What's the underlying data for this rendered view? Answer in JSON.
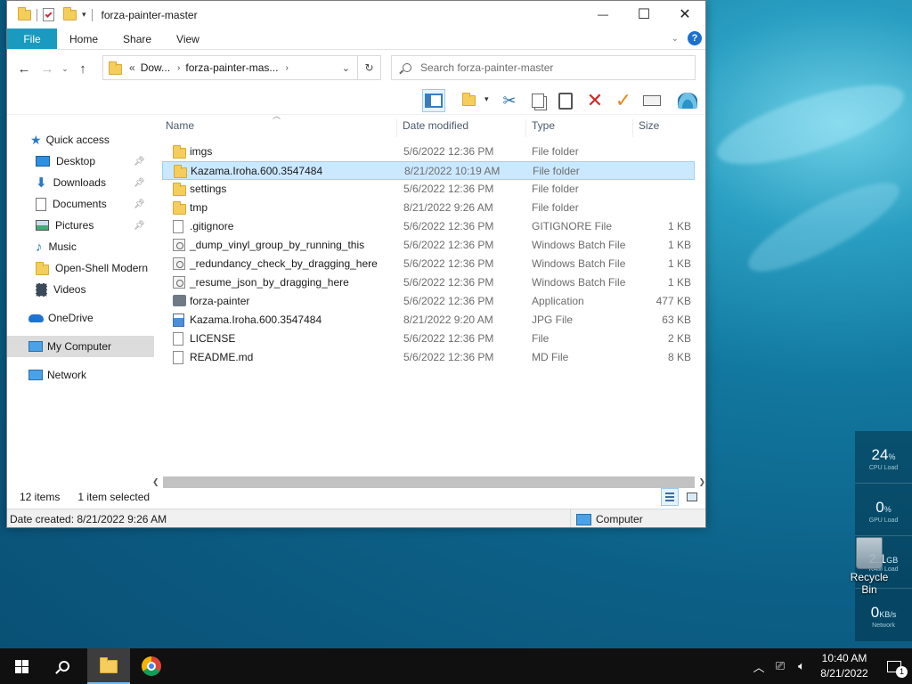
{
  "window": {
    "title": "forza-painter-master",
    "caption": {
      "minimize": "—",
      "maximize": "☐",
      "close": "✕"
    }
  },
  "ribbon": {
    "tabs": [
      "File",
      "Home",
      "Share",
      "View"
    ],
    "help": "?"
  },
  "address": {
    "prefix": "«",
    "crumbs": [
      "Dow...",
      "forza-painter-mas..."
    ],
    "search_placeholder": "Search forza-painter-master"
  },
  "nav": {
    "quick_access": "Quick access",
    "pinned": [
      "Desktop",
      "Downloads",
      "Documents",
      "Pictures"
    ],
    "others": [
      "Music",
      "Open-Shell Modern",
      "Videos"
    ],
    "onedrive": "OneDrive",
    "my_computer": "My Computer",
    "network": "Network"
  },
  "columns": {
    "name": "Name",
    "date": "Date modified",
    "type": "Type",
    "size": "Size"
  },
  "files": [
    {
      "name": "imgs",
      "date": "5/6/2022 12:36 PM",
      "type": "File folder",
      "size": "",
      "icon": "folder-icon"
    },
    {
      "name": "Kazama.Iroha.600.3547484",
      "date": "8/21/2022 10:19 AM",
      "type": "File folder",
      "size": "",
      "icon": "folder-icon",
      "selected": true
    },
    {
      "name": "settings",
      "date": "5/6/2022 12:36 PM",
      "type": "File folder",
      "size": "",
      "icon": "folder-icon"
    },
    {
      "name": "tmp",
      "date": "8/21/2022 9:26 AM",
      "type": "File folder",
      "size": "",
      "icon": "folder-icon"
    },
    {
      "name": ".gitignore",
      "date": "5/6/2022 12:36 PM",
      "type": "GITIGNORE File",
      "size": "1 KB",
      "icon": "file-icon"
    },
    {
      "name": "_dump_vinyl_group_by_running_this",
      "date": "5/6/2022 12:36 PM",
      "type": "Windows Batch File",
      "size": "1 KB",
      "icon": "batch-file-icon"
    },
    {
      "name": "_redundancy_check_by_dragging_here",
      "date": "5/6/2022 12:36 PM",
      "type": "Windows Batch File",
      "size": "1 KB",
      "icon": "batch-file-icon"
    },
    {
      "name": "_resume_json_by_dragging_here",
      "date": "5/6/2022 12:36 PM",
      "type": "Windows Batch File",
      "size": "1 KB",
      "icon": "batch-file-icon"
    },
    {
      "name": "forza-painter",
      "date": "5/6/2022 12:36 PM",
      "type": "Application",
      "size": "477 KB",
      "icon": "application-icon"
    },
    {
      "name": "Kazama.Iroha.600.3547484",
      "date": "8/21/2022 9:20 AM",
      "type": "JPG File",
      "size": "63 KB",
      "icon": "jpg-file-icon"
    },
    {
      "name": "LICENSE",
      "date": "5/6/2022 12:36 PM",
      "type": "File",
      "size": "2 KB",
      "icon": "file-icon"
    },
    {
      "name": "README.md",
      "date": "5/6/2022 12:36 PM",
      "type": "MD File",
      "size": "8 KB",
      "icon": "file-icon"
    }
  ],
  "status": {
    "item_count": "12 items",
    "selected": "1 item selected",
    "date_created": "Date created: 8/21/2022 9:26 AM",
    "location": "Computer"
  },
  "gadget": [
    {
      "value": "24",
      "unit": "%",
      "label": "CPU Load"
    },
    {
      "value": "0",
      "unit": "%",
      "label": "GPU Load"
    },
    {
      "value": "2.1",
      "unit": "GB",
      "label": "RAM Load"
    },
    {
      "value": "0",
      "unit": "KB/s",
      "label": "Network"
    }
  ],
  "desktop": {
    "recycle_bin": "Recycle Bin"
  },
  "taskbar": {
    "time": "10:40 AM",
    "date": "8/21/2022",
    "notification_count": "1"
  },
  "colors": {
    "accent": "#1a9abf",
    "selection": "#cce8ff",
    "taskbar": "#101010"
  }
}
